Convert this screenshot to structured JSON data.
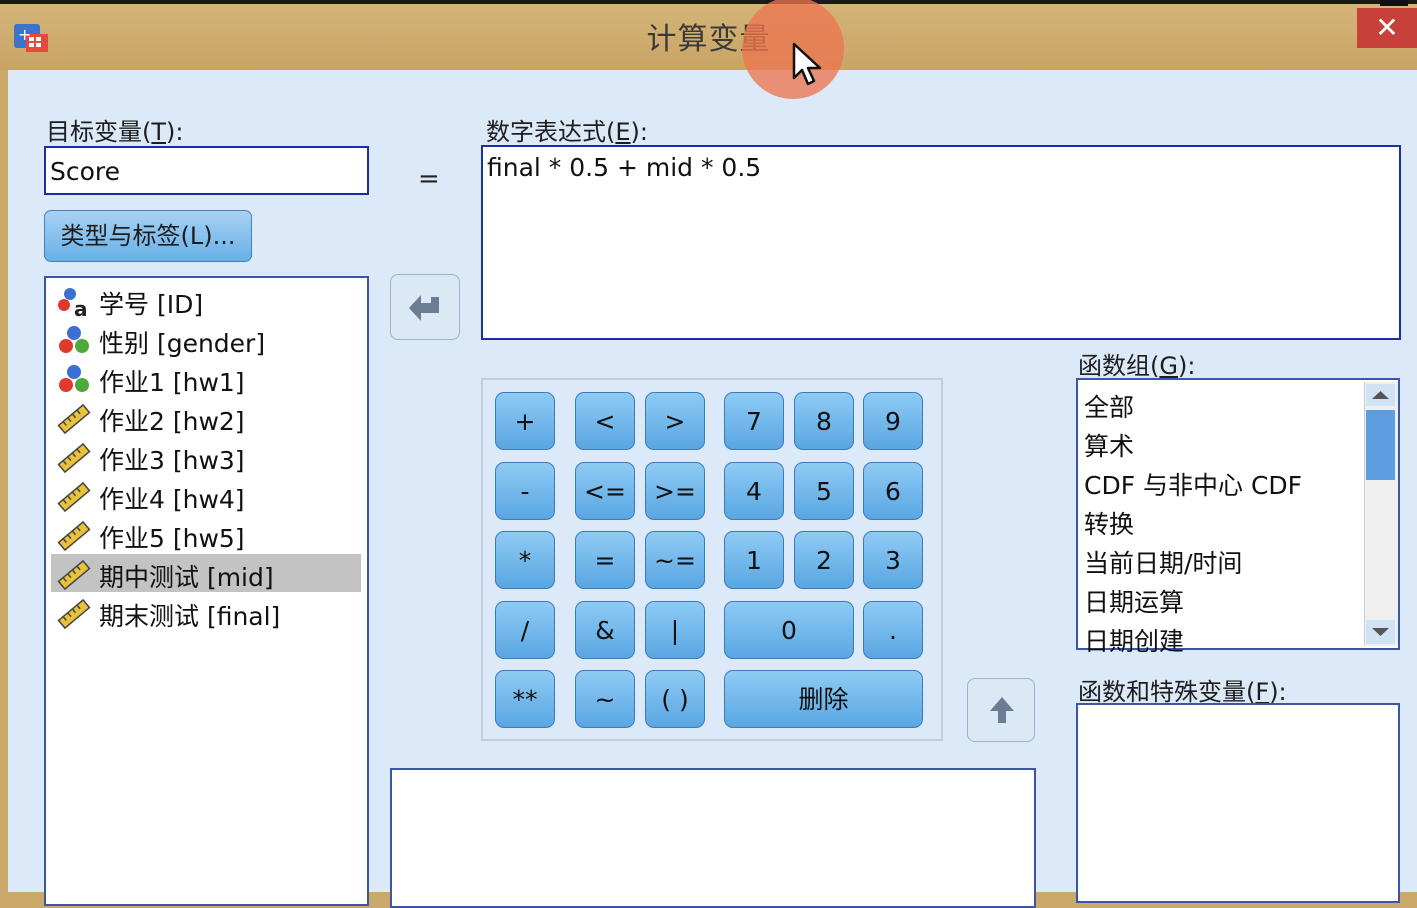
{
  "window": {
    "title": "计算变量",
    "close": "✕"
  },
  "target": {
    "label_text": "目标变量(",
    "label_key": "T",
    "label_end": "):",
    "value": "Score",
    "equals": "="
  },
  "type_label_button": "类型与标签(L)...",
  "variables": [
    {
      "text": "学号 [ID]",
      "icon": "nominal-string-icon"
    },
    {
      "text": "性别 [gender]",
      "icon": "nominal-icon"
    },
    {
      "text": "作业1 [hw1]",
      "icon": "nominal-icon"
    },
    {
      "text": "作业2 [hw2]",
      "icon": "scale-ruler-icon"
    },
    {
      "text": "作业3 [hw3]",
      "icon": "scale-ruler-icon"
    },
    {
      "text": "作业4 [hw4]",
      "icon": "scale-ruler-icon"
    },
    {
      "text": "作业5 [hw5]",
      "icon": "scale-ruler-icon"
    },
    {
      "text": "期中测试 [mid]",
      "icon": "scale-ruler-icon",
      "selected": true
    },
    {
      "text": "期末测试 [final]",
      "icon": "scale-ruler-icon"
    }
  ],
  "expression": {
    "label_text": "数字表达式(",
    "label_key": "E",
    "label_end": "):",
    "value": "final * 0.5 + mid * 0.5"
  },
  "keypad": {
    "row1": [
      "+",
      "<",
      ">",
      "7",
      "8",
      "9"
    ],
    "row2": [
      "-",
      "<=",
      ">=",
      "4",
      "5",
      "6"
    ],
    "row3": [
      "*",
      "=",
      "~=",
      "1",
      "2",
      "3"
    ],
    "row4": [
      "/",
      "&",
      "|",
      "0",
      "."
    ],
    "row5": [
      "**",
      "~",
      "( )",
      "删除"
    ]
  },
  "function_group": {
    "label_text": "函数组(",
    "label_key": "G",
    "label_end": "):",
    "items": [
      "全部",
      "算术",
      "CDF 与非中心 CDF",
      "转换",
      "当前日期/时间",
      "日期运算",
      "日期创建"
    ]
  },
  "functions": {
    "label_text": "函数和特殊变量(",
    "label_key": "F",
    "label_end": "):"
  },
  "colors": {
    "dialog_bg": "#dce9f8",
    "title_bg": "#c9a869",
    "close_bg": "#c7403a",
    "button": "#67b0e6",
    "selection": "#c3c3c3"
  }
}
